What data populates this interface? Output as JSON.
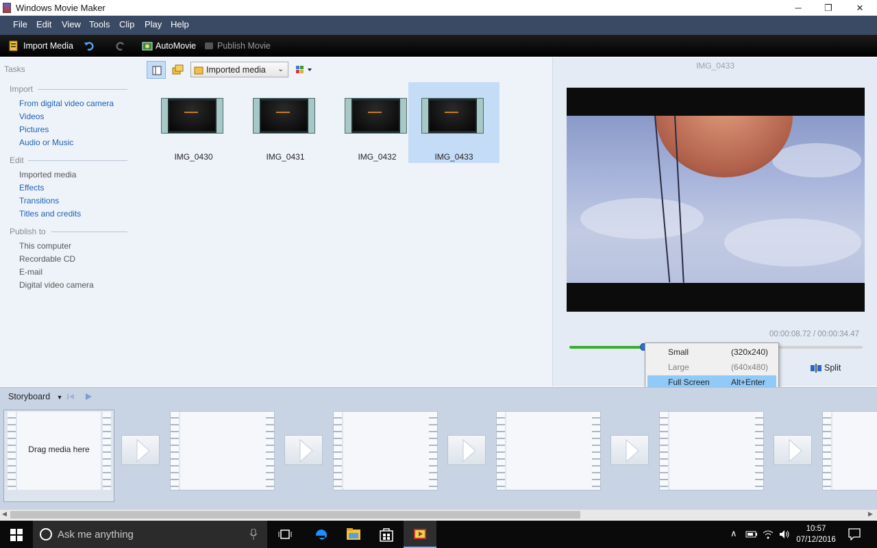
{
  "window": {
    "title": "Windows Movie Maker",
    "minimize_glyph": "─",
    "restore_glyph": "❐",
    "close_glyph": "✕"
  },
  "menu": [
    "File",
    "Edit",
    "View",
    "Tools",
    "Clip",
    "Play",
    "Help"
  ],
  "toolbar": {
    "import_media": "Import Media",
    "automovie": "AutoMovie",
    "publish_movie": "Publish Movie"
  },
  "tasks": {
    "title": "Tasks",
    "import": {
      "heading": "Import",
      "items": [
        "From digital video camera",
        "Videos",
        "Pictures",
        "Audio or Music"
      ]
    },
    "edit": {
      "heading": "Edit",
      "items": [
        "Imported media",
        "Effects",
        "Transitions",
        "Titles and credits"
      ]
    },
    "publish": {
      "heading": "Publish to",
      "items": [
        "This computer",
        "Recordable CD",
        "E-mail",
        "Digital video camera"
      ]
    }
  },
  "collection": {
    "selected": "Imported media"
  },
  "media": [
    {
      "name": "IMG_0430",
      "selected": false
    },
    {
      "name": "IMG_0431",
      "selected": false
    },
    {
      "name": "IMG_0432",
      "selected": false
    },
    {
      "name": "IMG_0433",
      "selected": true
    }
  ],
  "preview": {
    "clip_name": "IMG_0433",
    "timecode": "00:00:08.72 / 00:00:34.47",
    "progress": 0.253,
    "split_label": "Split"
  },
  "context_menu": [
    {
      "label": "Small",
      "shortcut": "(320x240)",
      "state": "normal"
    },
    {
      "label": "Large",
      "shortcut": "(640x480)",
      "state": "disabled"
    },
    {
      "label": "Full Screen",
      "shortcut": "Alt+Enter",
      "state": "highlighted"
    }
  ],
  "storyboard": {
    "label": "Storyboard",
    "placeholder": "Drag media here"
  },
  "taskbar": {
    "search_placeholder": "Ask me anything",
    "time": "10:57",
    "date": "07/12/2016"
  },
  "colors": {
    "menubar": "#3b4a64",
    "accent": "#1f5fb4",
    "selection": "#c5dcf7",
    "seek_fill": "#35b02c"
  }
}
